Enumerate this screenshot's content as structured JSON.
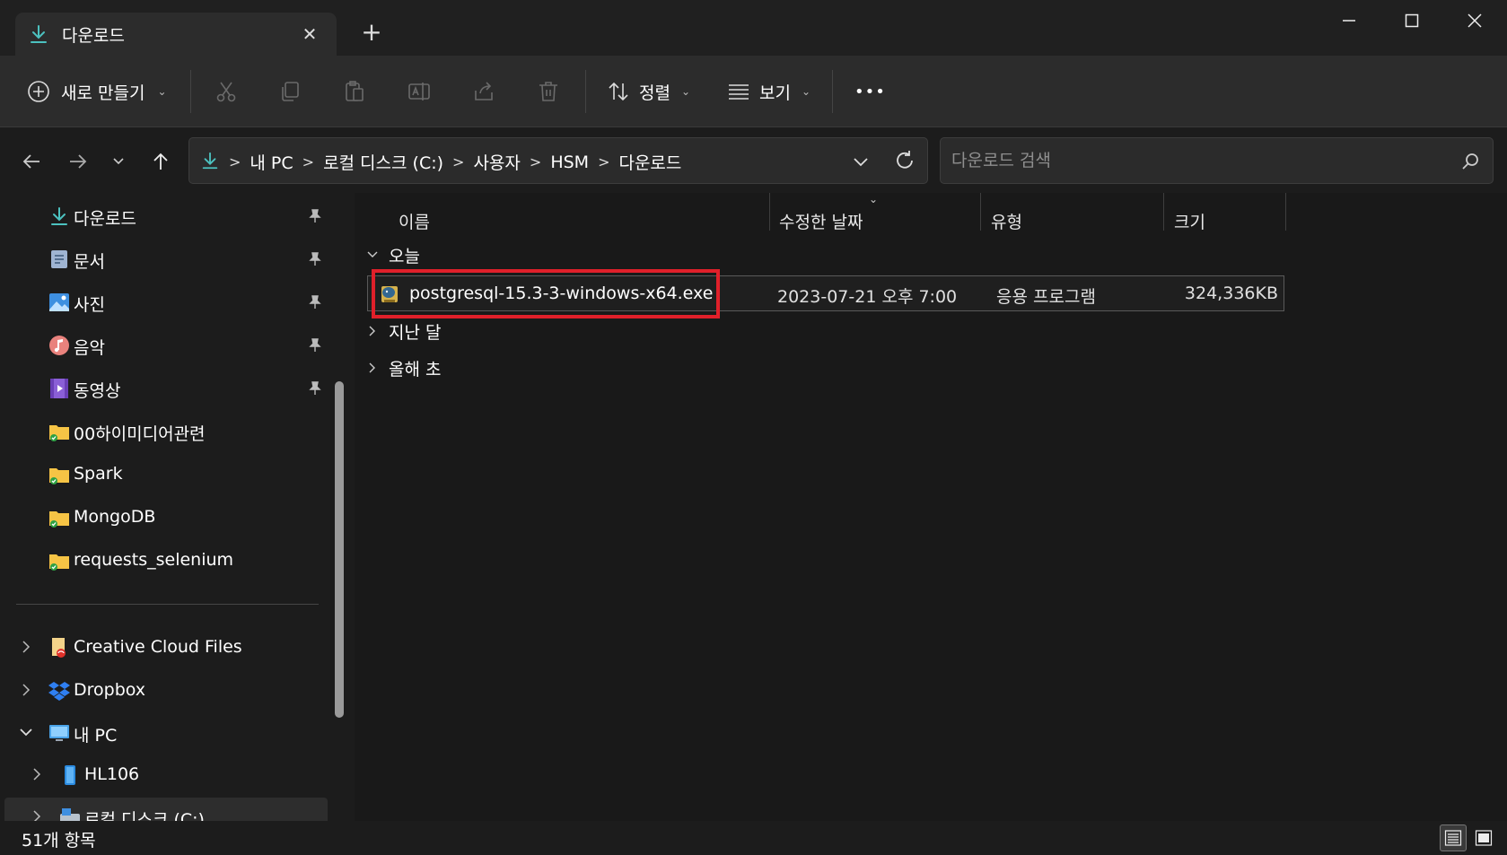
{
  "window": {
    "tab_title": "다운로드",
    "new_tab": "+",
    "accent": "#4cc2c0"
  },
  "toolbar": {
    "new_label": "새로 만들기",
    "sort_label": "정렬",
    "view_label": "보기",
    "more_label": "•••",
    "icons": [
      "cut-icon",
      "copy-icon",
      "paste-icon",
      "rename-icon",
      "share-icon",
      "delete-icon"
    ]
  },
  "address": {
    "crumbs": [
      "내 PC",
      "로컬 디스크 (C:)",
      "사용자",
      "HSM",
      "다운로드"
    ],
    "separator": ">"
  },
  "search": {
    "placeholder": "다운로드 검색"
  },
  "sidebar": {
    "pinned": [
      {
        "label": "다운로드",
        "icon": "download-icon"
      },
      {
        "label": "문서",
        "icon": "document-icon"
      },
      {
        "label": "사진",
        "icon": "picture-icon"
      },
      {
        "label": "음악",
        "icon": "music-icon"
      },
      {
        "label": "동영상",
        "icon": "video-icon"
      }
    ],
    "folders": [
      {
        "label": "00하이미디어관련",
        "icon": "folder-icon"
      },
      {
        "label": "Spark",
        "icon": "folder-icon"
      },
      {
        "label": "MongoDB",
        "icon": "folder-icon"
      },
      {
        "label": "requests_selenium",
        "icon": "folder-icon"
      }
    ],
    "tree": [
      {
        "label": "Creative Cloud Files",
        "icon": "creative-cloud-icon"
      },
      {
        "label": "Dropbox",
        "icon": "dropbox-icon"
      },
      {
        "label": "내 PC",
        "icon": "pc-icon"
      },
      {
        "label": "HL106",
        "icon": "drive-icon"
      },
      {
        "label": "로컬 디스크 (C:)",
        "icon": "disk-icon"
      }
    ]
  },
  "columns": {
    "name": "이름",
    "modified": "수정한 날짜",
    "type": "유형",
    "size": "크기"
  },
  "groups": {
    "today": "오늘",
    "last_month": "지난 달",
    "early_year": "올해 초"
  },
  "files": [
    {
      "name": "postgresql-15.3-3-windows-x64.exe",
      "modified": "2023-07-21 오후 7:00",
      "type": "응용 프로그램",
      "size": "324,336KB"
    }
  ],
  "status": {
    "count": "51개 항목"
  }
}
